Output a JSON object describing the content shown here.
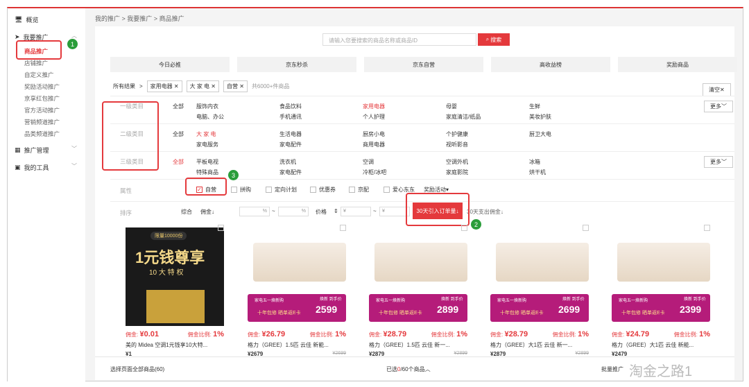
{
  "breadcrumb": {
    "a": "我的推广",
    "b": "我要推广",
    "c": "商品推广"
  },
  "sidebar": {
    "overview": "概览",
    "promote": "我要推广",
    "items": [
      "商品推广",
      "店铺推广",
      "自定义推广",
      "奖励活动推广",
      "京享红包推广",
      "官方活动推广",
      "营销频道推广",
      "品类频道推广"
    ],
    "manage": "推广管理",
    "tools": "我的工具"
  },
  "search": {
    "placeholder": "请输入您要搜索的商品名称或商品ID",
    "button": "搜索"
  },
  "tabs": [
    "今日必推",
    "京东秒杀",
    "京东自营",
    "高收益榜",
    "奖励商品"
  ],
  "results": {
    "label": "所有结果",
    "tags": [
      "家用电器",
      "大 家 电",
      "自营"
    ],
    "count": "共6000+件商品",
    "clear": "清空"
  },
  "cats": {
    "l1": {
      "label": "一级类目",
      "all": "全部",
      "items": [
        "服饰内衣",
        "食品饮料",
        "家用电器",
        "母婴",
        "生鲜",
        "电脑、办公",
        "手机通讯",
        "个人护理",
        "家庭清洁/纸品",
        "美妆护肤"
      ],
      "more": "更多"
    },
    "l2": {
      "label": "二级类目",
      "all": "全部",
      "items": [
        "大 家 电",
        "生活电器",
        "厨房小电",
        "个护健康",
        "厨卫大电",
        "家电服务",
        "家电配件",
        "商用电器",
        "视听影音"
      ]
    },
    "l3": {
      "label": "三级类目",
      "all": "全部",
      "items": [
        "平板电视",
        "洗衣机",
        "空调",
        "空调外机",
        "冰箱",
        "特殊商品",
        "家电配件",
        "冷柜/冰吧",
        "家庭影院",
        "烘干机"
      ],
      "more": "更多"
    }
  },
  "attr": {
    "label": "属性",
    "items": [
      "自营",
      "拼购",
      "定向计划",
      "优惠券",
      "京配",
      "爱心东东"
    ],
    "dropdown": "奖励活动"
  },
  "sort": {
    "label": "排序",
    "default": "综合",
    "commission": "佣金",
    "pct": "%",
    "tilde": "~",
    "price": "价格",
    "yen": "¥",
    "active": "30天引入订单量",
    "spend": "30天支出佣金"
  },
  "ad": {
    "tag": "限量10000份",
    "main": "1元钱尊享",
    "sub": "10 大 特 权"
  },
  "product_labels": {
    "comm": "佣金: ",
    "rate": "佣金比例: "
  },
  "products": [
    {
      "commission": "¥0.01",
      "rate": "1%",
      "title": "美的 Midea 空调1元钱享10大特...",
      "price": "¥1",
      "orig": "",
      "big": ""
    },
    {
      "commission": "¥26.79",
      "rate": "1%",
      "title": "格力（GREE）1.5匹 云佳 新能...",
      "price": "¥2679",
      "orig": "¥2699",
      "big": "2599"
    },
    {
      "commission": "¥28.79",
      "rate": "1%",
      "title": "格力（GREE）1.5匹 云佳 新一...",
      "price": "¥2879",
      "orig": "¥2899",
      "big": "2899"
    },
    {
      "commission": "¥28.79",
      "rate": "1%",
      "title": "格力（GREE）大1匹 云佳 新一...",
      "price": "¥2879",
      "orig": "¥2899",
      "big": "2699"
    },
    {
      "commission": "¥24.79",
      "rate": "1%",
      "title": "格力（GREE）大1匹 云佳 新能...",
      "price": "¥2479",
      "orig": "",
      "big": "2399"
    }
  ],
  "banner": {
    "title": "家电五一焕新购",
    "sub": "十年包修 晒单返E卡",
    "new": "焕新 到手价"
  },
  "footer": {
    "select_all": "选择页面全部商品(60)",
    "selected_prefix": "已选",
    "selected_num": "0",
    "selected_suffix": "/60个商品",
    "batch": "批量推广",
    "watermark": "淘金之路1"
  },
  "annotations": [
    "1",
    "2",
    "3"
  ],
  "colors": {
    "accent": "#e4393c",
    "badge": "#2a9d3a"
  }
}
